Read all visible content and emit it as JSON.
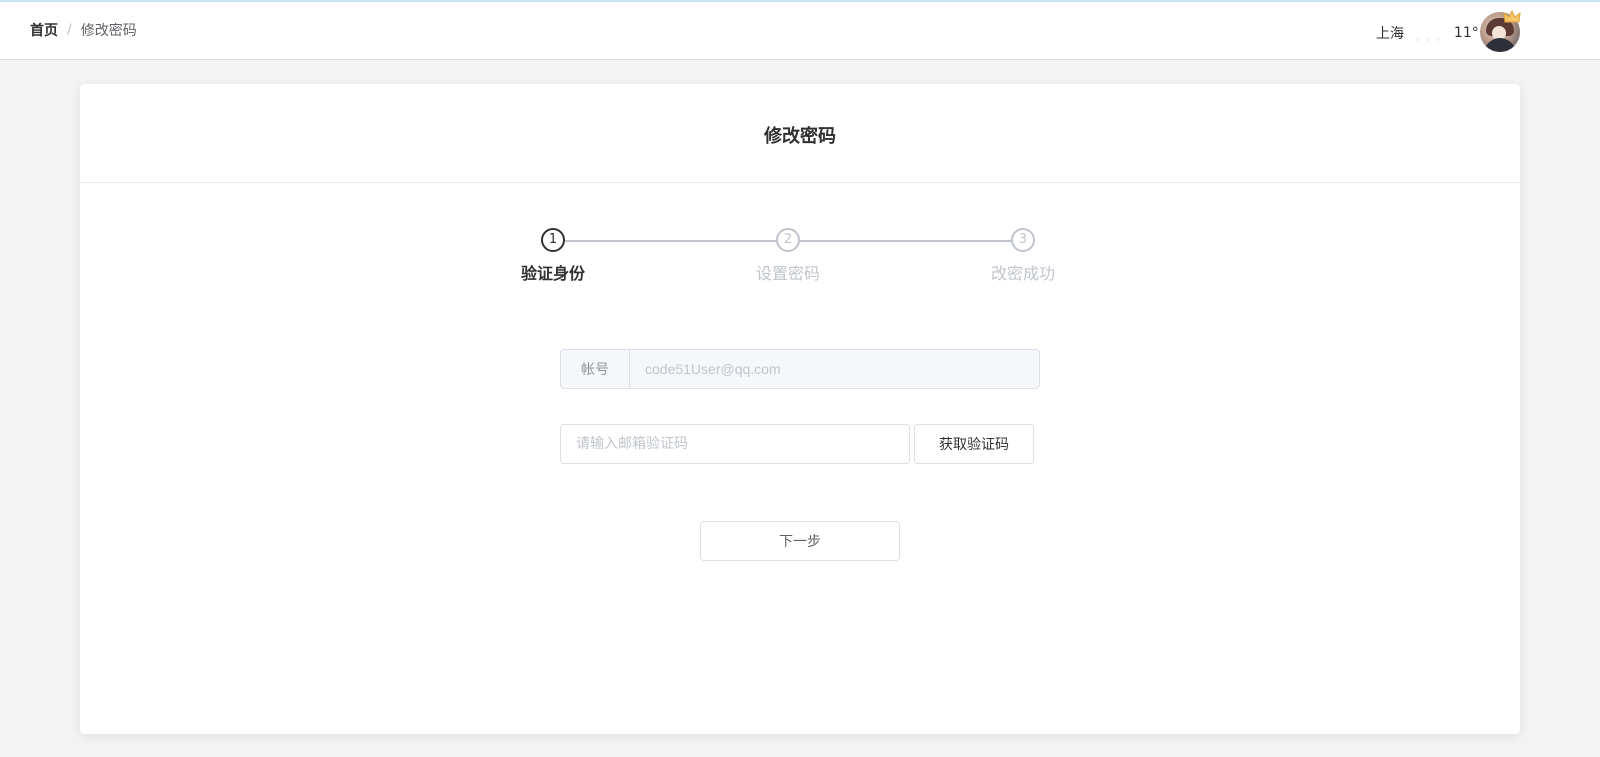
{
  "breadcrumb": {
    "home": "首页",
    "separator": "/",
    "current": "修改密码"
  },
  "weather": {
    "city": "上海",
    "icon_name": "weather-icon",
    "icon_glyph": ", , ,",
    "temperature": "11°"
  },
  "user": {
    "avatar_icon": "avatar"
  },
  "card": {
    "title": "修改密码"
  },
  "steps": [
    {
      "number": "1",
      "label": "验证身份",
      "status": "active"
    },
    {
      "number": "2",
      "label": "设置密码",
      "status": "wait"
    },
    {
      "number": "3",
      "label": "改密成功",
      "status": "wait"
    }
  ],
  "form": {
    "account_label": "帐号",
    "account_value": "code51User@qq.com",
    "code_placeholder": "请输入邮箱验证码",
    "code_value": "",
    "get_code_label": "获取验证码",
    "next_label": "下一步"
  },
  "colors": {
    "accent": "#303133",
    "inactive": "#c0c4cc",
    "border": "#dcdfe6",
    "page_bg": "#f3f3f3",
    "top_line": "#c9e6f7"
  }
}
